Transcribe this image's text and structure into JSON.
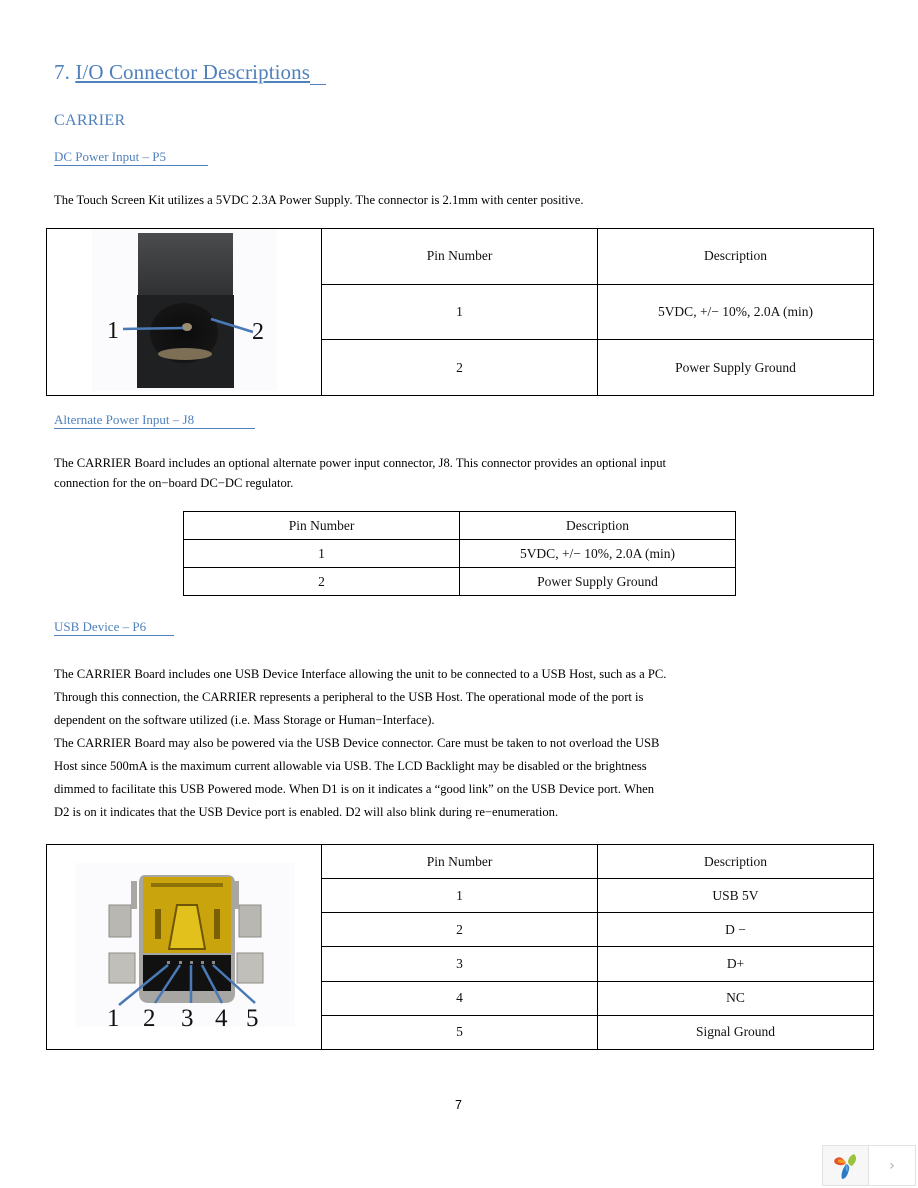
{
  "heading": {
    "number": "7.",
    "title": "I/O Connector Descriptions"
  },
  "subheading": "CARRIER",
  "sections": {
    "dc_power": {
      "title": "DC Power Input – P5",
      "text": "The Touch Screen Kit utilizes a 5VDC 2.3A Power Supply. The connector is 2.1mm with center positive.",
      "image_labels": [
        "1",
        "2"
      ],
      "table": {
        "headers": [
          "Pin Number",
          "Description"
        ],
        "rows": [
          [
            "1",
            "5VDC, +/− 10%, 2.0A (min)"
          ],
          [
            "2",
            "Power Supply Ground"
          ]
        ]
      }
    },
    "alt_power": {
      "title": "Alternate Power Input – J8",
      "lines": [
        "The CARRIER Board includes an optional alternate power input connector, J8. This connector provides an optional input",
        "connection for the on−board DC−DC regulator."
      ],
      "table": {
        "headers": [
          "Pin Number",
          "Description"
        ],
        "rows": [
          [
            "1",
            "5VDC, +/− 10%, 2.0A (min)"
          ],
          [
            "2",
            "Power Supply Ground"
          ]
        ]
      }
    },
    "usb_device": {
      "title": "USB Device – P6",
      "lines": [
        "The CARRIER Board includes one USB Device Interface allowing the unit to be connected to a USB Host, such as a PC.",
        "Through this connection, the CARRIER represents a peripheral to the USB Host. The operational mode of the port is",
        "dependent on the software utilized (i.e. Mass Storage or Human−Interface).",
        "The CARRIER Board may also be powered via the USB Device connector. Care must be taken to not overload the USB",
        "Host since 500mA is the maximum current allowable via USB. The LCD Backlight may be disabled or the brightness",
        "dimmed to facilitate this USB Powered mode.  When D1 is on it indicates a “good link” on the USB Device port.  When",
        "D2 is on it indicates that the USB Device port is enabled.  D2 will also blink during re−enumeration."
      ],
      "image_labels": [
        "1",
        "2",
        "3",
        "4",
        "5"
      ],
      "table": {
        "headers": [
          "Pin Number",
          "Description"
        ],
        "rows": [
          [
            "1",
            "USB 5V"
          ],
          [
            "2",
            "D −"
          ],
          [
            "3",
            "D+"
          ],
          [
            "4",
            "NC"
          ],
          [
            "5",
            "Signal Ground"
          ]
        ]
      }
    }
  },
  "page_number": "7",
  "viewer_widget": {
    "logo_icon": "pinwheel-logo-icon",
    "next_icon": "chevron-right-icon",
    "next_glyph": "›"
  },
  "colors": {
    "heading": "#4f81bd",
    "callout_line": "#4a7ab5"
  }
}
